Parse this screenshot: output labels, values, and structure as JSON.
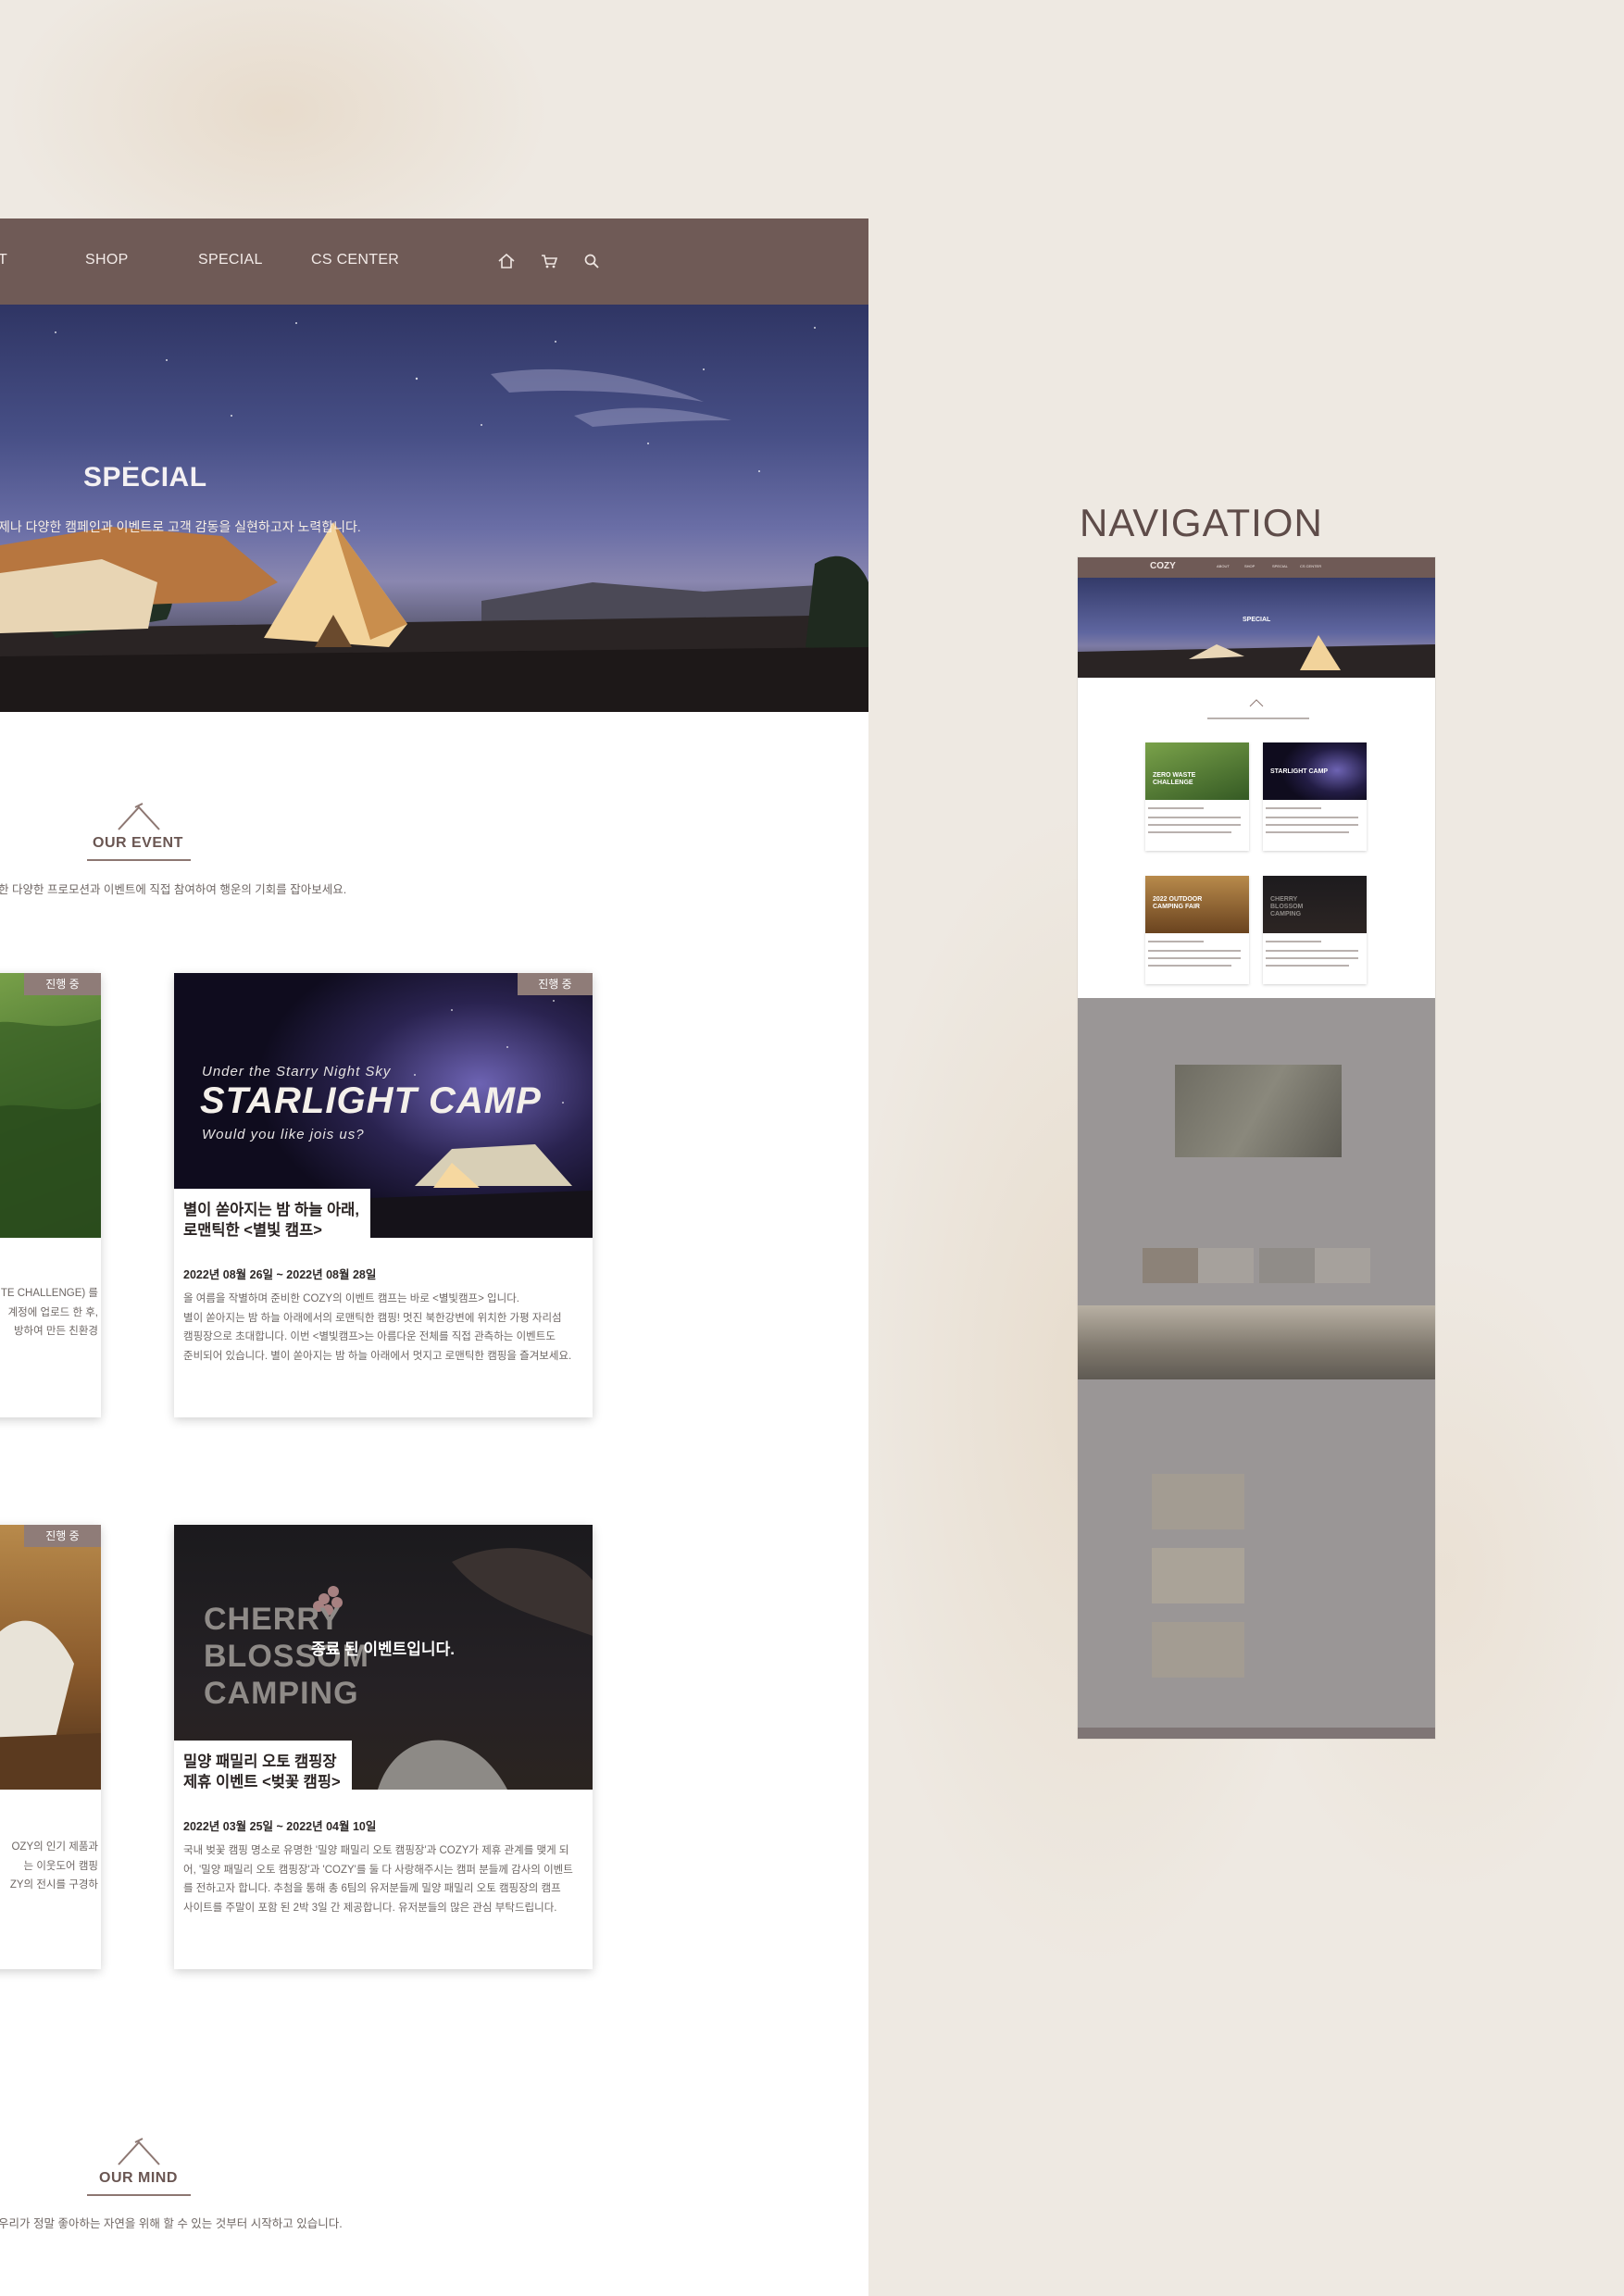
{
  "nav": {
    "items": [
      "T",
      "SHOP",
      "SPECIAL",
      "CS CENTER"
    ],
    "icons": [
      "home-icon",
      "cart-icon",
      "search-icon"
    ],
    "bg_color": "#6f5a56"
  },
  "hero": {
    "title": "SPECIAL",
    "subtitle": "제나 다양한 캠페인과 이벤트로 고객 감동을 실현하고자 노력합니다."
  },
  "our_event": {
    "title": "OUR EVENT",
    "desc": "한 다양한 프로모션과 이벤트에 직접 참여하여 행운의 기회를 잡아보세요."
  },
  "cards": [
    {
      "badge": "진행 중",
      "body": "TE CHALLENGE) 를\n계정에 업로드 한 후,\n방하여 만든 친환경"
    },
    {
      "badge": "진행 중",
      "banner_small": "Under the Starry Night Sky",
      "banner_big": "STARLIGHT CAMP",
      "banner_tag": "Would you like jois us?",
      "title": "별이 쏟아지는 밤 하늘 아래,\n로맨틱한 <별빛 캠프>",
      "date": "2022년 08월 26일 ~ 2022년 08월 28일",
      "body": "올 여름을 작별하며 준비한 COZY의 이벤트 캠프는 바로 <별빛캠프> 입니다.\n별이 쏟아지는 밤 하늘 아래에서의 로맨틱한 캠핑! 멋진 북한강변에 위치한 가평 자리섬\n캠핑장으로 초대합니다. 이번 <별빛캠프>는 아름다운 전체를 직접 관측하는 이벤트도\n준비되어 있습니다. 별이 쏟아지는 밤 하늘 아래에서 멋지고 로맨틱한 캠핑을 즐겨보세요."
    },
    {
      "badge": "진행 중",
      "body": "OZY의 인기 제품과\n는 이웃도어 캠핑\nZY의 전시를 구경하"
    },
    {
      "banner_big_lines": [
        "CHERRY",
        "BLOSSOM",
        "CAMPING"
      ],
      "ended_text": "종료 된 이벤트입니다.",
      "title": "밀양 패밀리 오토 캠핑장\n제휴 이벤트 <벚꽃 캠핑>",
      "date": "2022년 03월 25일 ~ 2022년 04월 10일",
      "body": "국내 벚꽃 캠핑 명소로 유명한 '밀양 패밀리 오토 캠핑장'과 COZY가 제휴 관계를 맺게 되\n어, '밀양 패밀리 오토 캠핑장'과 'COZY'를 둘 다 사랑해주시는 캠퍼 분들께 감사의 이벤트\n를 전하고자 합니다. 추첨을 통해 총 6팀의 유저분들께 밀양 패밀리 오토 캠핑장의 캠프\n사이트를 주말이 포함 된 2박 3일 간 제공합니다. 유저분들의 많은 관심 부탁드립니다."
    }
  ],
  "our_mind": {
    "title": "OUR MIND",
    "desc": "우리가 정말 좋아하는 자연을 위해 할 수 있는 것부터 시작하고 있습니다."
  },
  "navigation_panel": {
    "heading": "NAVIGATION",
    "logo": "COZY",
    "hero_title": "SPECIAL",
    "thumb_cards": [
      "ZERO WASTE CHALLENGE",
      "STARLIGHT CAMP",
      "2022 OUTDOOR CAMPING FAIR",
      "CHERRY BLOSSOM CAMPING"
    ]
  },
  "colors": {
    "accent": "#6f5a56",
    "badge": "#8f7c78",
    "paper": "#eee9e2"
  }
}
